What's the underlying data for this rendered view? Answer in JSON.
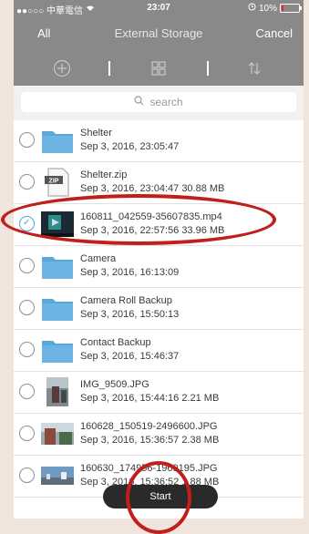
{
  "status_bar": {
    "carrier": "●●○○○ 中華電信",
    "time": "23:07",
    "battery": "10%",
    "battery_color": "#e22222"
  },
  "nav": {
    "left": "All",
    "title": "External Storage",
    "right": "Cancel"
  },
  "toolbar": {
    "icons": [
      "add-circle-icon",
      "grid-view-icon",
      "sort-icon"
    ]
  },
  "search": {
    "placeholder": "search"
  },
  "files": [
    {
      "name": "Shelter",
      "meta": "Sep 3, 2016, 23:05:47",
      "kind": "folder",
      "checked": false
    },
    {
      "name": "Shelter.zip",
      "meta": "Sep 3, 2016, 23:04:47  30.88 MB",
      "kind": "zip",
      "checked": false
    },
    {
      "name": "160811_042559-35607835.mp4",
      "meta": "Sep 3, 2016, 22:57:56  33.96 MB",
      "kind": "video",
      "checked": true
    },
    {
      "name": "Camera",
      "meta": "Sep 3, 2016, 16:13:09",
      "kind": "folder",
      "checked": false
    },
    {
      "name": "Camera Roll Backup",
      "meta": "Sep 3, 2016, 15:50:13",
      "kind": "folder",
      "checked": false
    },
    {
      "name": "Contact Backup",
      "meta": "Sep 3, 2016, 15:46:37",
      "kind": "folder",
      "checked": false
    },
    {
      "name": "IMG_9509.JPG",
      "meta": "Sep 3, 2016, 15:44:16  2.21 MB",
      "kind": "photo",
      "checked": false
    },
    {
      "name": "160628_150519-2496600.JPG",
      "meta": "Sep 3, 2016, 15:36:57  2.38 MB",
      "kind": "photo",
      "checked": false
    },
    {
      "name": "160630_174956-1969195.JPG",
      "meta": "Sep 3, 2016, 15:36:52  1.88 MB",
      "kind": "photo",
      "checked": false
    }
  ],
  "start_button": "Start",
  "colors": {
    "bar": "#8b8889",
    "folder": "#5aa7dc",
    "annotation": "#c01f1a"
  }
}
